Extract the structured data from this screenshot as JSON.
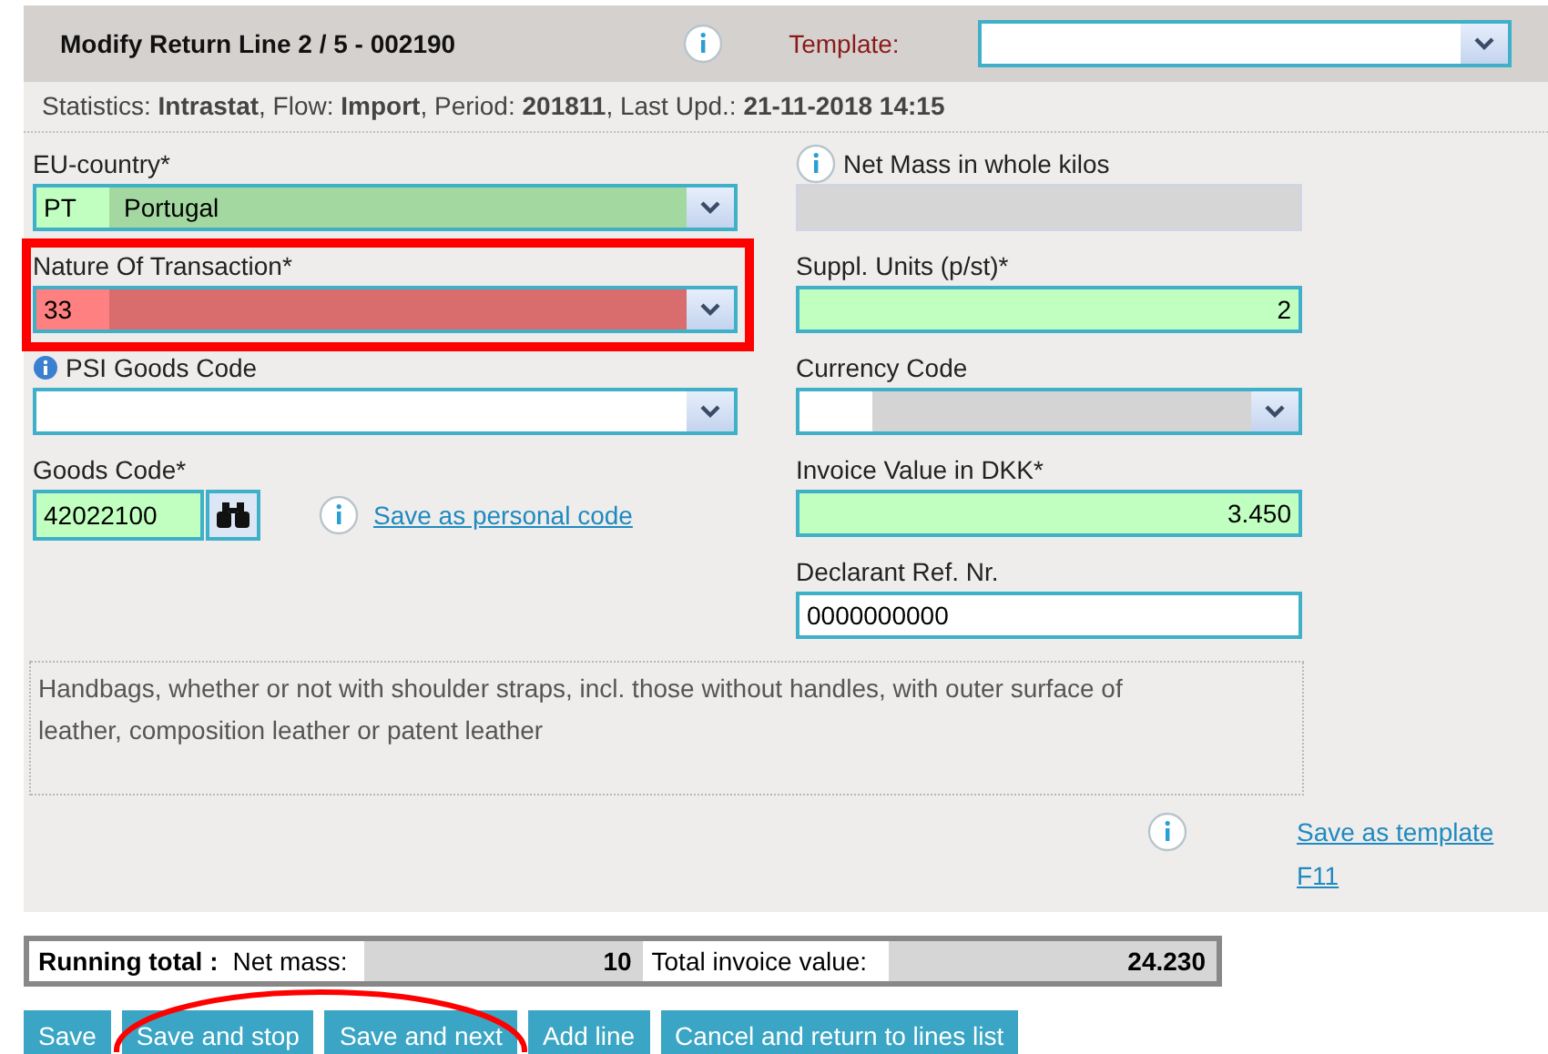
{
  "header": {
    "title": "Modify Return Line 2 / 5 - 002190",
    "info": true,
    "template_label": "Template:"
  },
  "statistics": "Statistics: **Intrastat**, Flow: **Import**, Period: **201811**, Last Upd.: **21-11-2018 14:15**",
  "left_fields": [
    {
      "kind": "code-select",
      "label": "EU-country*",
      "code": "PT",
      "value": "Portugal",
      "valid": true,
      "error": false,
      "info": false,
      "highlighted": false
    },
    {
      "kind": "code-select",
      "label": "Nature Of Transaction*",
      "code": "33",
      "error": true,
      "info": false,
      "highlighted": true
    },
    {
      "kind": "select",
      "label": "PSI Goods Code",
      "valid": false,
      "error": false,
      "info": true,
      "highlighted": false
    },
    {
      "kind": "lookup",
      "label": "Goods Code*",
      "value": "42022100",
      "valid": true,
      "error": false,
      "info": false,
      "highlighted": false,
      "link": "Save as personal code"
    }
  ],
  "right_fields": [
    {
      "kind": "number",
      "label": "Net Mass in whole kilos",
      "disabled": true,
      "info": true
    },
    {
      "kind": "number",
      "label": "Suppl. Units (p/st)*",
      "value": "2",
      "disabled": false,
      "valid": true,
      "error": false,
      "info": false
    },
    {
      "kind": "code-select",
      "label": "Currency Code",
      "disabled": false,
      "valid": false,
      "error": false,
      "info": false
    },
    {
      "kind": "number",
      "label": "Invoice Value in DKK*",
      "value": "3.450",
      "disabled": false,
      "valid": true,
      "error": false,
      "info": false
    },
    {
      "kind": "text",
      "label": "Declarant Ref. Nr.",
      "value": "0000000000",
      "disabled": false,
      "valid": false,
      "error": false,
      "info": false
    }
  ],
  "description": "Handbags, whether or not with shoulder straps, incl. those without handles, with outer surface of leather, composition leather or patent leather",
  "template_link": "Save as template F11",
  "running_total": {
    "label": "Running total :",
    "net_mass_label": "Net mass:",
    "net_mass": "10",
    "invoice_label": "Total invoice value:",
    "invoice": "24.230"
  },
  "buttons": [
    "Save",
    "Save and stop",
    "Save and next",
    "Add line",
    "Cancel and return to lines list"
  ]
}
